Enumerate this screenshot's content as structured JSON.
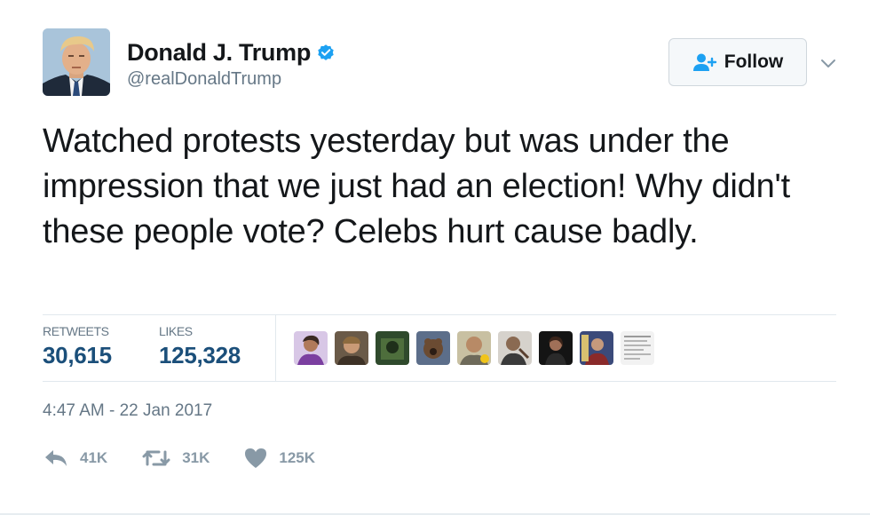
{
  "author": {
    "display_name": "Donald J. Trump",
    "handle": "@realDonaldTrump",
    "verified_icon": "verified-badge-icon"
  },
  "follow_button": {
    "label": "Follow",
    "icon": "add-user-icon"
  },
  "tweet": {
    "text": "Watched protests yesterday but was under the impression that we just had an election! Why didn't these people vote? Celebs hurt cause badly."
  },
  "stats": {
    "retweets_label": "RETWEETS",
    "retweets_value": "30,615",
    "likes_label": "LIKES",
    "likes_value": "125,328"
  },
  "timestamp": "4:47 AM - 22 Jan 2017",
  "actions": {
    "reply_count": "41K",
    "retweet_count": "31K",
    "like_count": "125K"
  },
  "colors": {
    "verified_blue": "#1da1f2",
    "stat_value": "#1b4f7a",
    "muted": "#657786",
    "action_gray": "#8899a6"
  }
}
